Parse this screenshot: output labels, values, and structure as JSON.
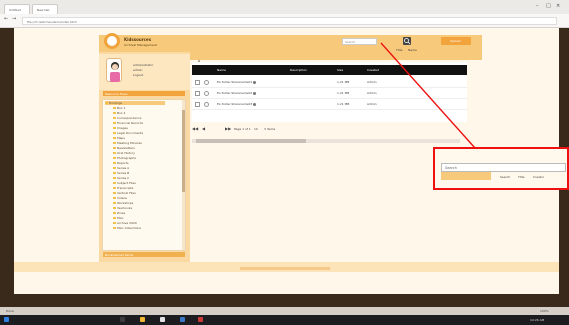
{
  "browser": {
    "tabs": [
      {
        "label": "Untitled"
      },
      {
        "label": "New tab"
      }
    ],
    "url": "file:///C:/ebirmesutern/index.html"
  },
  "app": {
    "brand": "Kidssources",
    "subtitle": "Archival Management",
    "profile_lines": [
      "administrator",
      "admin",
      "Logout"
    ],
    "search": {
      "placeholder": "Search",
      "value": "Search"
    },
    "upload_label": "Upload",
    "filter_labels": [
      "Title",
      "Name"
    ],
    "sidebar_headers": [
      "Resource Trees",
      "Taxonomy / Subject Group Folder",
      "Bookmarked Items"
    ]
  },
  "tree": {
    "items": [
      "Holdings",
      "Box 1",
      "Box 2",
      "Correspondence",
      "Financial Records",
      "Images",
      "Legal Documents",
      "Maps",
      "Meeting Minutes",
      "Newsletters",
      "Oral History",
      "Photographs",
      "Reports",
      "Series A",
      "Series B",
      "Series C",
      "Subject Files",
      "Transcripts",
      "Vertical Files",
      "Videos",
      "Workshops",
      "Yearbooks",
      "Zines",
      "Misc",
      "Archive 2020",
      "Misc Collections"
    ]
  },
  "table": {
    "headers": [
      "",
      "",
      "Name",
      "Description",
      "Size",
      "Created",
      ""
    ],
    "rows": [
      {
        "name": "Ex-folder-Sharename01",
        "size": "1.21 MB",
        "created": "Admin"
      },
      {
        "name": "Ex-folder-Sharename02",
        "size": "1.21 MB",
        "created": "Admin"
      },
      {
        "name": "Ex-folder-Sharename03",
        "size": "1.21 MB",
        "created": "Admin"
      }
    ],
    "pager": {
      "info": "Page 1 of 1",
      "per_page": "10",
      "total": "3 items"
    }
  },
  "callout": {
    "search_value": "Search",
    "labels": [
      "Search",
      "Title",
      "Creator"
    ]
  },
  "status": {
    "left": "Done",
    "right": "100%"
  },
  "taskbar": {
    "time": "10:26 AM"
  },
  "colors": {
    "accent": "#f2a33c",
    "callout_border": "#ee1111",
    "header_bg": "#111111"
  }
}
